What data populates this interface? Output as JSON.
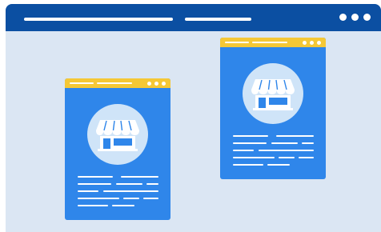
{
  "theme": {
    "window_background": "#dbe6f3",
    "title_bar_color": "#0b4fa2",
    "card_color": "#2f86ea",
    "card_header_color": "#f5c836",
    "icon_circle_color": "#cfe4f8",
    "line_color": "#ffffff"
  },
  "window": {
    "title_bar_placeholder_lines": 2,
    "menu_dots": 3
  },
  "cards": [
    {
      "name": "store-card-left",
      "icon": "storefront-icon",
      "header_dots": 3,
      "text_line_rows": 5
    },
    {
      "name": "store-card-right",
      "icon": "storefront-icon",
      "header_dots": 3,
      "text_line_rows": 5
    }
  ]
}
